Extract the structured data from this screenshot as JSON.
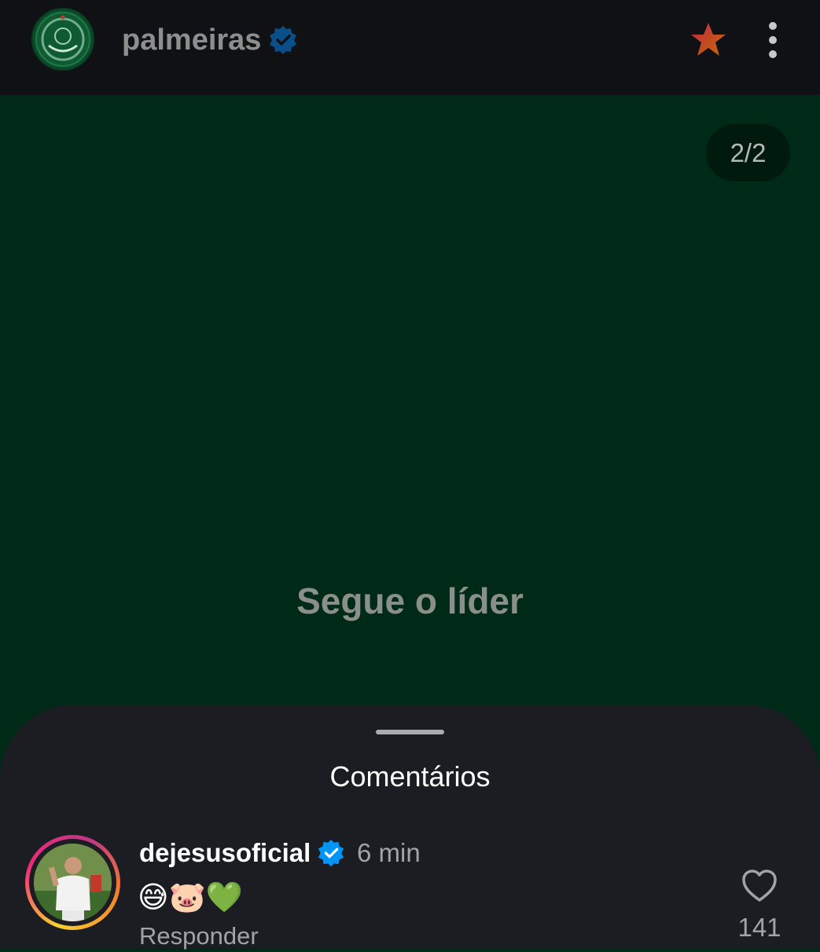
{
  "header": {
    "username": "palmeiras",
    "avatar_icon": "palmeiras-crest-icon",
    "verified_icon": "verified-badge-icon",
    "favorite_icon": "star-icon",
    "more_icon": "more-vertical-icon"
  },
  "slide": {
    "counter": "2/2",
    "caption": "Segue o líder",
    "background_color": "#002a18"
  },
  "comments_sheet": {
    "title": "Comentários",
    "comments": [
      {
        "username": "dejesusoficial",
        "verified": true,
        "time": "6 min",
        "text": "😅🐷💚",
        "reply_label": "Responder",
        "likes": "141",
        "like_icon": "heart-outline-icon"
      }
    ]
  },
  "colors": {
    "topbar": "#0f1114",
    "sheet": "#1b1d22",
    "verified_blue": "#0095f6",
    "star_gradient": [
      "#ff2d55",
      "#ff8a00"
    ]
  }
}
